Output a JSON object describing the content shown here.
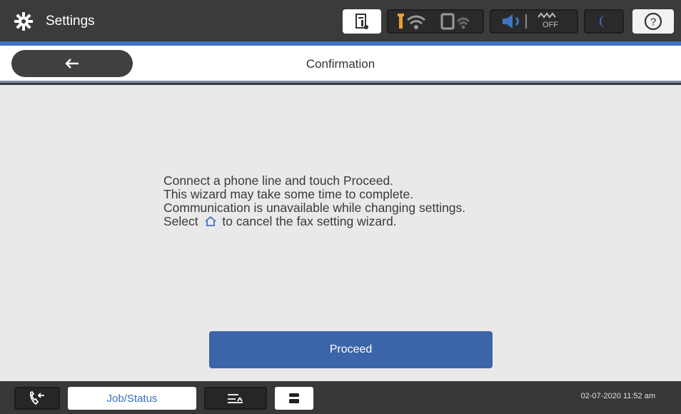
{
  "topbar": {
    "title": "Settings",
    "icons": [
      "gear-icon",
      "ink-status-icon",
      "wifi-icon",
      "wifi-direct-icon",
      "speaker-icon",
      "fax-off-icon",
      "sleep-moon-icon",
      "help-icon"
    ],
    "fax_off_label": "OFF",
    "help_label": "?"
  },
  "header": {
    "back_icon": "arrow-left-icon",
    "back_label": "←",
    "title": "Confirmation"
  },
  "content": {
    "message_lines": [
      "Connect a phone line and touch Proceed.",
      "This wizard may take some time to complete.",
      "Communication is unavailable while changing settings."
    ],
    "message_last_before": "Select",
    "message_last_after": "to cancel the fax setting wizard.",
    "proceed_label": "Proceed"
  },
  "bottombar": {
    "job_status_label": "Job/Status",
    "datetime": "02-07-2020 11:52 am"
  },
  "colors": {
    "accent": "#3f74c4",
    "primary_button": "#3c64a8",
    "content_bg": "#e9e9e9",
    "bar_bg": "#3b3b3b"
  }
}
